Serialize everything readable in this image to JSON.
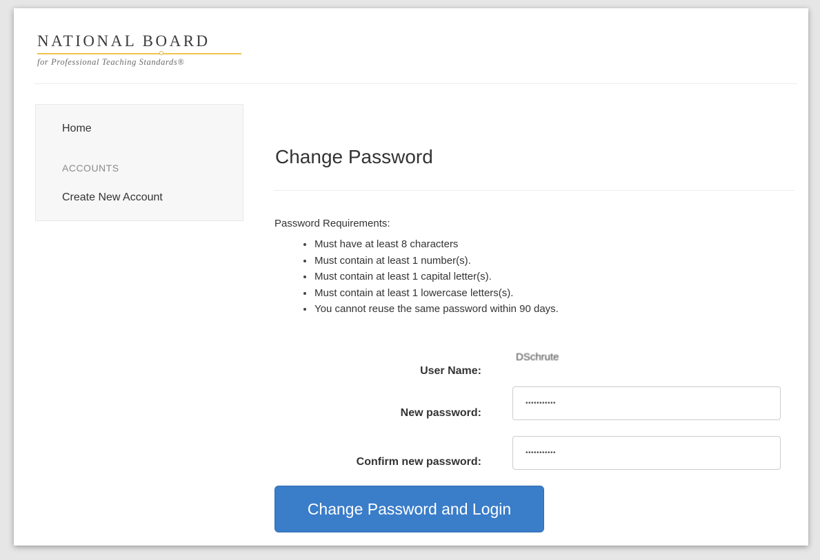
{
  "logo": {
    "title": "NATIONAL BOARD",
    "subtitle": "for Professional Teaching Standards®"
  },
  "sidebar": {
    "home_label": "Home",
    "section_label": "ACCOUNTS",
    "create_account_label": "Create New Account"
  },
  "main": {
    "title": "Change Password",
    "requirements_label": "Password Requirements:",
    "requirements": [
      "Must have at least 8 characters",
      "Must contain at least 1 number(s).",
      "Must contain at least 1 capital letter(s).",
      "Must contain at least 1 lowercase letters(s).",
      "You cannot reuse the same password within 90 days."
    ]
  },
  "form": {
    "username_label": "User Name:",
    "username_value": "DSchrute",
    "new_password_label": "New password:",
    "new_password_value": "•••••••••••",
    "confirm_password_label": "Confirm new password:",
    "confirm_password_value": "•••••••••••",
    "submit_label": "Change Password and Login"
  },
  "colors": {
    "accent": "#3a7dc9",
    "logo_rule": "#f1c24b"
  }
}
